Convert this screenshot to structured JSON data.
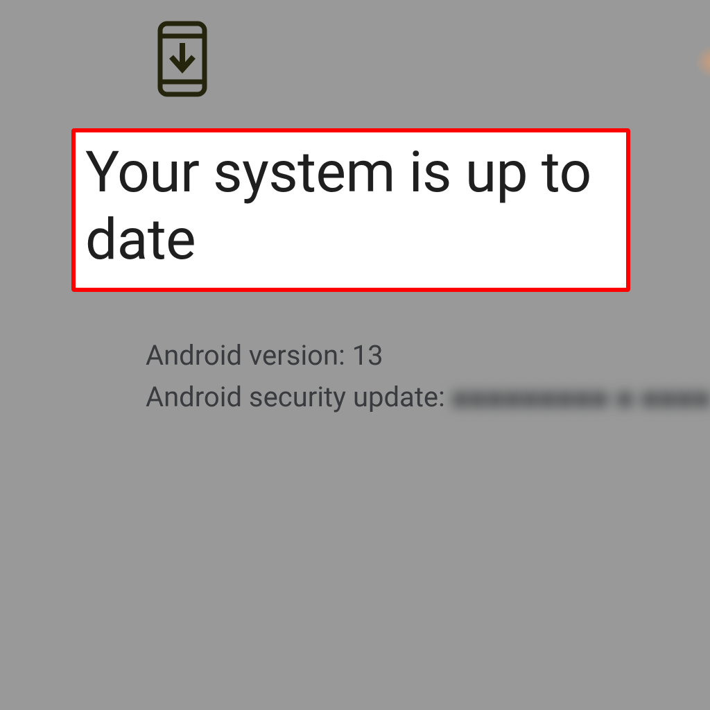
{
  "icon": {
    "name": "system-update-icon",
    "stroke": "#3e3f17"
  },
  "highlight": {
    "title": "Your system is up to date",
    "border_color": "#ff0000"
  },
  "details": {
    "android_version_label": "Android version: ",
    "android_version_value": "13",
    "security_update_label": "Android security update: ",
    "security_update_value_redacted": "■■■■■■■■■  ■  ■■■■"
  }
}
